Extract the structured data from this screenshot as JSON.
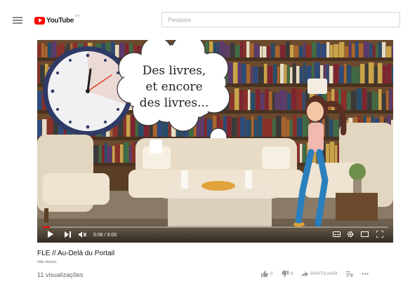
{
  "header": {
    "logo_text": "YouTube",
    "logo_country": "PT",
    "search_placeholder": "Pesquisa"
  },
  "player": {
    "speech_bubble_lines": [
      "Des livres,",
      "et encore",
      "des livres..."
    ],
    "time_current": "0:06",
    "time_total": "5:00",
    "progress_fraction": 0.02
  },
  "video": {
    "title": "FLE // Au-Delà du Portail",
    "visibility": "Não listado",
    "views": "11 visualizações"
  },
  "actions": {
    "like_count": "0",
    "dislike_count": "0",
    "share_label": "PARTILHAR"
  },
  "colors": {
    "brand_red": "#ff0000",
    "bookshelf": "#6b4a2e",
    "sofa": "#e8dcc8"
  }
}
